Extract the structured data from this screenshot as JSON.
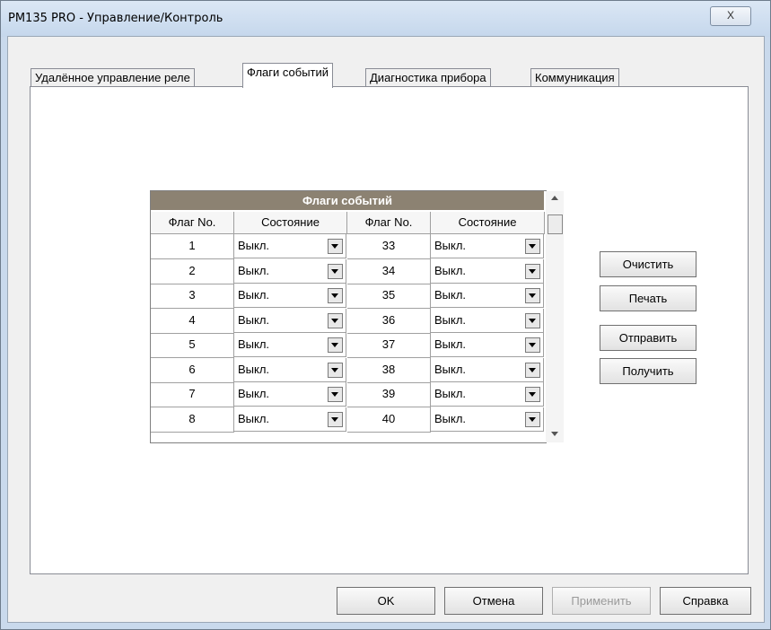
{
  "window": {
    "title": "PM135 PRO - Управление/Контроль",
    "close_glyph": "X"
  },
  "tabs": [
    {
      "label": "Удалённое управление реле",
      "active": false
    },
    {
      "label": "Флаги событий",
      "active": true
    },
    {
      "label": "Диагностика прибора",
      "active": false
    },
    {
      "label": "Коммуникация",
      "active": false
    }
  ],
  "table": {
    "title": "Флаги событий",
    "columns": [
      "Флаг No.",
      "Состояние",
      "Флаг No.",
      "Состояние"
    ],
    "rows": [
      {
        "left_no": "1",
        "left_state": "Выкл.",
        "right_no": "33",
        "right_state": "Выкл."
      },
      {
        "left_no": "2",
        "left_state": "Выкл.",
        "right_no": "34",
        "right_state": "Выкл."
      },
      {
        "left_no": "3",
        "left_state": "Выкл.",
        "right_no": "35",
        "right_state": "Выкл."
      },
      {
        "left_no": "4",
        "left_state": "Выкл.",
        "right_no": "36",
        "right_state": "Выкл."
      },
      {
        "left_no": "5",
        "left_state": "Выкл.",
        "right_no": "37",
        "right_state": "Выкл."
      },
      {
        "left_no": "6",
        "left_state": "Выкл.",
        "right_no": "38",
        "right_state": "Выкл."
      },
      {
        "left_no": "7",
        "left_state": "Выкл.",
        "right_no": "39",
        "right_state": "Выкл."
      },
      {
        "left_no": "8",
        "left_state": "Выкл.",
        "right_no": "40",
        "right_state": "Выкл."
      }
    ]
  },
  "side_buttons": {
    "clear": "Очистить",
    "print": "Печать",
    "send": "Отправить",
    "receive": "Получить"
  },
  "footer": {
    "ok": "OK",
    "cancel": "Отмена",
    "apply": "Применить",
    "help": "Справка"
  }
}
